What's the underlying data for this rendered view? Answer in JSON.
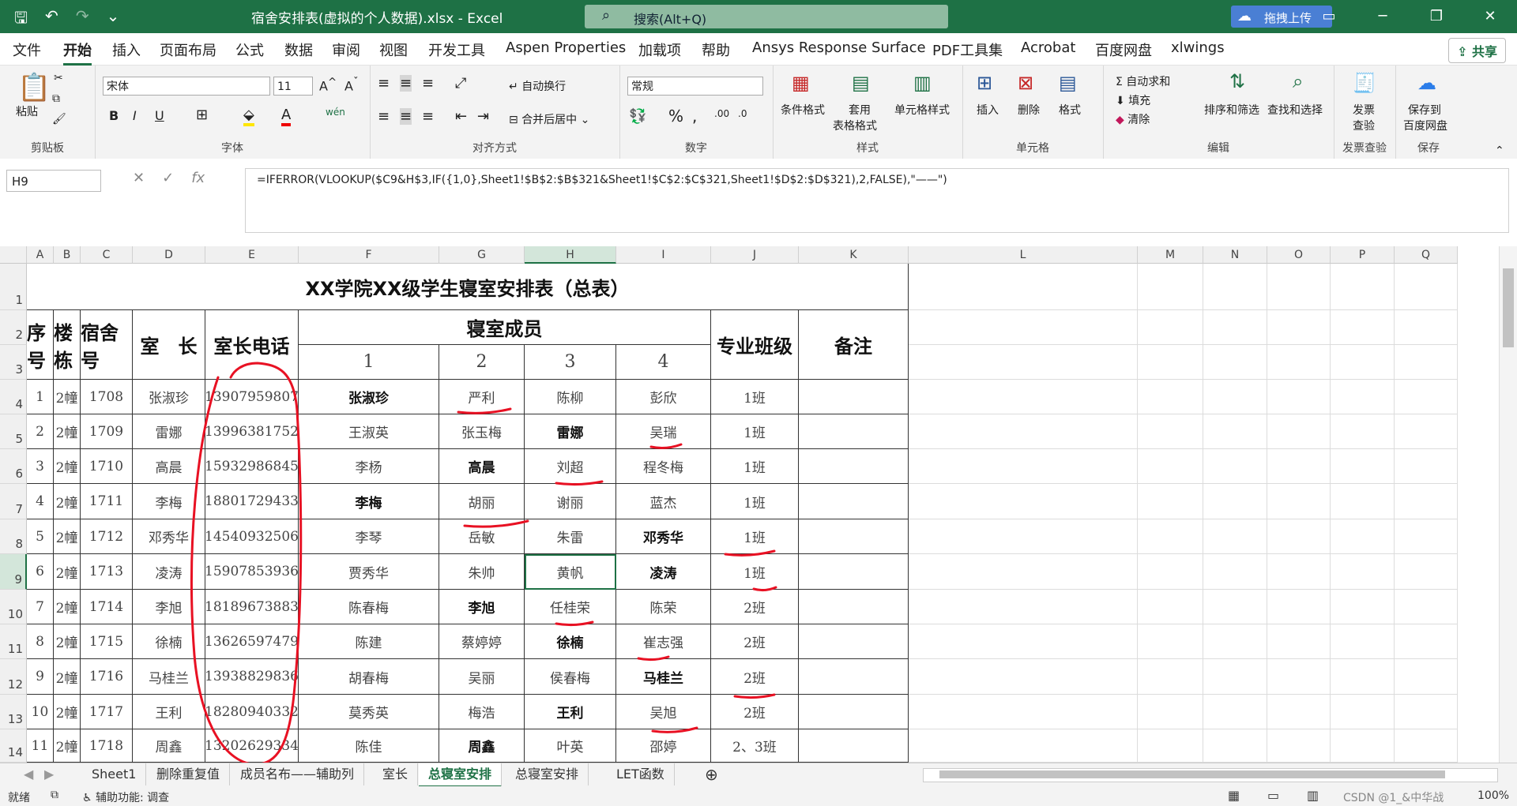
{
  "title_bar": {
    "doc_title": "宿舍安排表(虚拟的个人数据).xlsx - Excel",
    "search_placeholder": "搜索(Alt+Q)",
    "baidu_upload": "拖拽上传"
  },
  "menu": [
    "文件",
    "开始",
    "插入",
    "页面布局",
    "公式",
    "数据",
    "审阅",
    "视图",
    "开发工具",
    "Aspen Properties",
    "加载项",
    "帮助",
    "Ansys Response Surface",
    "PDF工具集",
    "Acrobat",
    "百度网盘",
    "xlwings"
  ],
  "share_label": "共享",
  "ribbon": {
    "clipboard": {
      "paste": "粘贴",
      "label": "剪贴板"
    },
    "font": {
      "name": "宋体",
      "size": "11",
      "label": "字体",
      "bold": "B",
      "italic": "I",
      "underline": "U"
    },
    "align": {
      "wrap": "自动换行",
      "merge": "合并后居中",
      "label": "对齐方式"
    },
    "number": {
      "format": "常规",
      "label": "数字"
    },
    "styles": {
      "cond": "条件格式",
      "table": "套用",
      "table2": "表格格式",
      "cell": "单元格样式",
      "label": "样式"
    },
    "cells": {
      "insert": "插入",
      "delete": "删除",
      "format": "格式",
      "label": "单元格"
    },
    "editing": {
      "autosum": "自动求和",
      "fill": "填充",
      "clear": "清除",
      "sort": "排序和筛选",
      "find": "查找和选择",
      "label": "编辑"
    },
    "invoice": {
      "check": "发票",
      "check2": "查验",
      "label": "发票查验"
    },
    "save": {
      "save": "保存到",
      "save2": "百度网盘",
      "label": "保存"
    }
  },
  "formula_bar": {
    "name_box": "H9",
    "formula": "=IFERROR(VLOOKUP($C9&H$3,IF({1,0},Sheet1!$B$2:$B$321&Sheet1!$C$2:$C$321,Sheet1!$D$2:$D$321),2,FALSE),\"——\")"
  },
  "columns": [
    "A",
    "B",
    "C",
    "D",
    "E",
    "F",
    "G",
    "H",
    "I",
    "J",
    "K",
    "L",
    "M",
    "N",
    "O",
    "P",
    "Q"
  ],
  "sheet": {
    "title": "XX学院XX级学生寝室安排表（总表）",
    "headers": {
      "seq": "序号",
      "building": "楼栋",
      "room": "宿舍号",
      "leader": "室　长",
      "phone": "室长电话",
      "members": "寝室成员",
      "class": "专业班级",
      "note": "备注"
    },
    "member_nums": [
      "1",
      "2",
      "3",
      "4"
    ],
    "rows": [
      {
        "r": "4",
        "seq": "1",
        "bld": "2幢",
        "room": "1708",
        "leader": "张淑珍",
        "phone": "13907959807",
        "m": [
          "张淑珍",
          "严利",
          "陈柳",
          "彭欣"
        ],
        "cls": "1班",
        "bold": 0
      },
      {
        "r": "5",
        "seq": "2",
        "bld": "2幢",
        "room": "1709",
        "leader": "雷娜",
        "phone": "13996381752",
        "m": [
          "王淑英",
          "张玉梅",
          "雷娜",
          "吴瑞"
        ],
        "cls": "1班",
        "bold": 2
      },
      {
        "r": "6",
        "seq": "3",
        "bld": "2幢",
        "room": "1710",
        "leader": "高晨",
        "phone": "15932986845",
        "m": [
          "李杨",
          "高晨",
          "刘超",
          "程冬梅"
        ],
        "cls": "1班",
        "bold": 1
      },
      {
        "r": "7",
        "seq": "4",
        "bld": "2幢",
        "room": "1711",
        "leader": "李梅",
        "phone": "18801729433",
        "m": [
          "李梅",
          "胡丽",
          "谢丽",
          "蓝杰"
        ],
        "cls": "1班",
        "bold": 0
      },
      {
        "r": "8",
        "seq": "5",
        "bld": "2幢",
        "room": "1712",
        "leader": "邓秀华",
        "phone": "14540932506",
        "m": [
          "李琴",
          "岳敏",
          "朱雷",
          "邓秀华"
        ],
        "cls": "1班",
        "bold": 3
      },
      {
        "r": "9",
        "seq": "6",
        "bld": "2幢",
        "room": "1713",
        "leader": "凌涛",
        "phone": "15907853936",
        "m": [
          "贾秀华",
          "朱帅",
          "黄帆",
          "凌涛"
        ],
        "cls": "1班",
        "bold": 3
      },
      {
        "r": "10",
        "seq": "7",
        "bld": "2幢",
        "room": "1714",
        "leader": "李旭",
        "phone": "18189673883",
        "m": [
          "陈春梅",
          "李旭",
          "任桂荣",
          "陈荣"
        ],
        "cls": "2班",
        "bold": 1
      },
      {
        "r": "11",
        "seq": "8",
        "bld": "2幢",
        "room": "1715",
        "leader": "徐楠",
        "phone": "13626597479",
        "m": [
          "陈建",
          "蔡婷婷",
          "徐楠",
          "崔志强"
        ],
        "cls": "2班",
        "bold": 2
      },
      {
        "r": "12",
        "seq": "9",
        "bld": "2幢",
        "room": "1716",
        "leader": "马桂兰",
        "phone": "13938829836",
        "m": [
          "胡春梅",
          "吴丽",
          "侯春梅",
          "马桂兰"
        ],
        "cls": "2班",
        "bold": 3
      },
      {
        "r": "13",
        "seq": "10",
        "bld": "2幢",
        "room": "1717",
        "leader": "王利",
        "phone": "18280940332",
        "m": [
          "莫秀英",
          "梅浩",
          "王利",
          "吴旭"
        ],
        "cls": "2班",
        "bold": 2
      },
      {
        "r": "14",
        "seq": "11",
        "bld": "2幢",
        "room": "1718",
        "leader": "周鑫",
        "phone": "13202629334",
        "m": [
          "陈佳",
          "周鑫",
          "叶英",
          "邵婷"
        ],
        "cls": "2、3班",
        "bold": 1
      }
    ]
  },
  "sheet_tabs": [
    "Sheet1",
    "删除重复值",
    "成员名布——辅助列",
    "室长",
    "总寝室安排",
    "总寝室安排",
    "LET函数"
  ],
  "active_tab": 4,
  "status": {
    "ready": "就绪",
    "accessibility": "辅助功能: 调查",
    "zoom": "100%",
    "watermark": "CSDN @1_&中华战"
  },
  "accent_color": "#1e7145",
  "annotation_color": "#e81123"
}
